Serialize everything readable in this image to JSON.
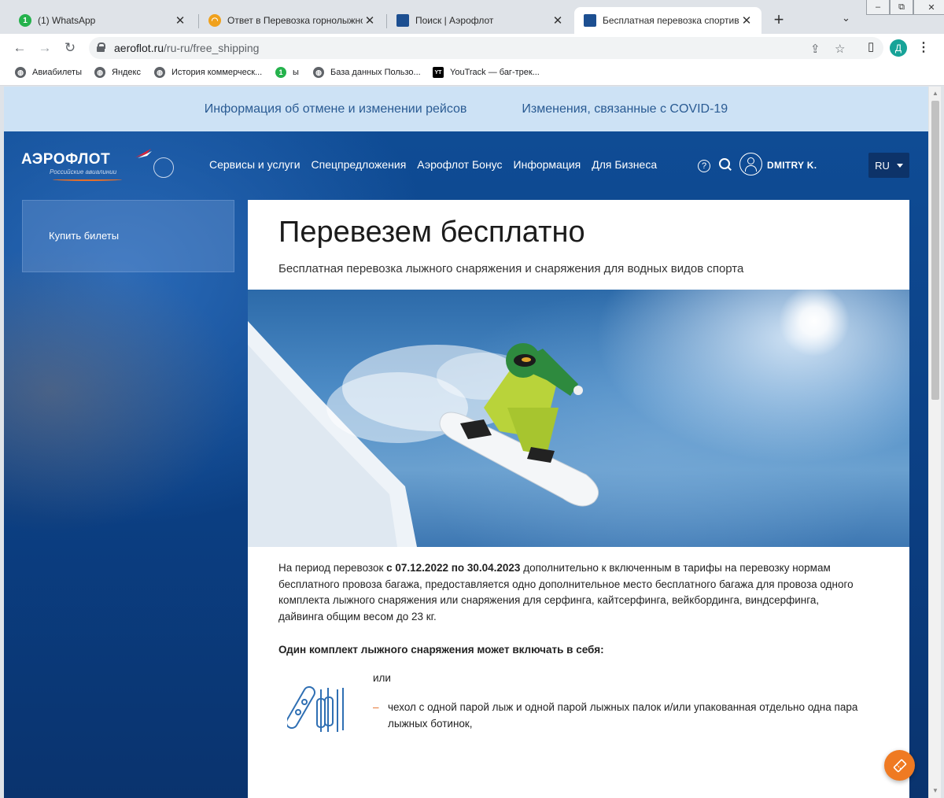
{
  "browser": {
    "tabs": [
      {
        "label": "(1) WhatsApp",
        "favicon": "whatsapp-icon",
        "badge": "1"
      },
      {
        "label": "Ответ в Перевозка горнолыжного",
        "favicon": "notification-icon"
      },
      {
        "label": "Поиск | Аэрофлот",
        "favicon": "aeroflot-icon"
      },
      {
        "label": "Бесплатная перевозка спортивног",
        "favicon": "aeroflot-icon",
        "active": true
      }
    ],
    "new_tab": "+",
    "url_host": "aeroflot.ru",
    "url_path": "/ru-ru/free_shipping",
    "profile_initial": "Д",
    "bookmarks": [
      {
        "label": "Авиабилеты",
        "icon": "globe-icon"
      },
      {
        "label": "Яндекс",
        "icon": "globe-icon"
      },
      {
        "label": "История коммерческ...",
        "icon": "globe-icon"
      },
      {
        "label": "ы",
        "icon": "whatsapp-icon",
        "badge": "1"
      },
      {
        "label": "База данных Пользо...",
        "icon": "globe-icon"
      },
      {
        "label": "YouTrack — баг-трек...",
        "icon": "youtrack-icon",
        "badge": "YT"
      }
    ]
  },
  "alerts": {
    "cancellations": "Информация об отмене и изменении рейсов",
    "covid": "Изменения, связанные с COVID-19"
  },
  "header": {
    "logo_text": "АЭРОФЛОТ",
    "logo_sub": "Российские авиалинии",
    "nav": [
      "Сервисы и услуги",
      "Спецпредложения",
      "Аэрофлот Бонус",
      "Информация",
      "Для Бизнеса"
    ],
    "help_glyph": "?",
    "username": "DMITRY K.",
    "lang": "RU"
  },
  "sidebar": {
    "buy_tickets": "Купить билеты"
  },
  "article": {
    "title": "Перевезем бесплатно",
    "subtitle": "Бесплатная перевозка лыжного снаряжения и снаряжения для водных видов спорта",
    "p1_a": "На период перевозок ",
    "p1_bold": "с 07.12.2022 по 30.04.2023",
    "p1_b": " дополнительно к включенным в тарифы на перевозку нормам бесплатного провоза багажа, предоставляется одно дополнительное место бесплатного багажа для провоза одного комплекта лыжного снаряжения или снаряжения для серфинга, кайтсерфинга, вейкбординга, виндсерфинга, дайвинга общим весом до 23 кг.",
    "kit_heading": "Один комплект лыжного снаряжения может включать в себя:",
    "or": "или",
    "bullet_dash": "–",
    "bullet1": "чехол с одной парой лыж и одной парой лыжных палок и/или упакованная отдельно одна пара лыжных ботинок,"
  },
  "colors": {
    "brand_blue": "#0b3f83",
    "accent_orange": "#ef7a22",
    "alert_bg": "#cde2f5"
  }
}
